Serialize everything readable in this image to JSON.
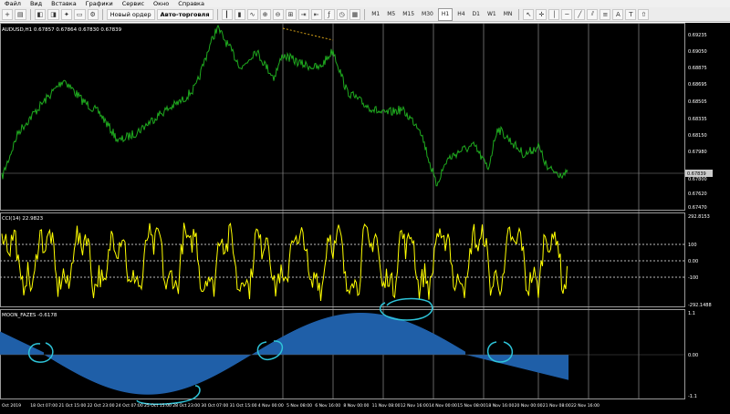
{
  "menu": [
    "Файл",
    "Вид",
    "Вставка",
    "Графики",
    "Сервис",
    "Окно",
    "Справка"
  ],
  "toolbar": {
    "new_order": "Новый ордер",
    "auto_trading": "Авто-торговля",
    "timeframes": [
      "M1",
      "M5",
      "M15",
      "M30",
      "H1",
      "H4",
      "D1",
      "W1",
      "MN"
    ]
  },
  "price_pane": {
    "label": "AUDUSD,H1  0.67857 0.67864 0.67830 0.67839",
    "axis_ticks": [
      "0.69235",
      "0.69050",
      "0.68875",
      "0.68695",
      "0.68505",
      "0.68335",
      "0.68150",
      "0.67980",
      "0.67800",
      "0.67620",
      "0.67470"
    ],
    "current_price": "0.67839"
  },
  "cci_pane": {
    "label": "CCI(14) 22.9823",
    "axis_ticks": [
      "292.8153",
      "100",
      "0.00",
      "-100",
      "-292.1488"
    ]
  },
  "moon_pane": {
    "label": "MOON_FAZES -0.6178",
    "axis_ticks": [
      "1.1",
      "0.00",
      "-1.1"
    ]
  },
  "time_axis": [
    "Oct 2019",
    "18 Oct 07:00",
    "21 Oct 15:00",
    "22 Oct 23:00",
    "24 Oct 07:00",
    "25 Oct 15:00",
    "28 Oct 23:00",
    "30 Oct 07:00",
    "31 Oct 15:00",
    "4 Nov 00:00",
    "5 Nov 08:00",
    "6 Nov 16:00",
    "8 Nov 00:00",
    "11 Nov 08:00",
    "12 Nov 16:00",
    "14 Nov 00:00",
    "15 Nov 08:00",
    "18 Nov 16:00",
    "20 Nov 00:00",
    "21 Nov 08:00",
    "22 Nov 16:00"
  ],
  "colors": {
    "price": "#1faa1f",
    "cci": "#ffff00",
    "moon": "#1f5fa8",
    "annotation": "#2ec4d8",
    "grid_v": "#aaaaaa",
    "frame": "#9a9a9a"
  }
}
